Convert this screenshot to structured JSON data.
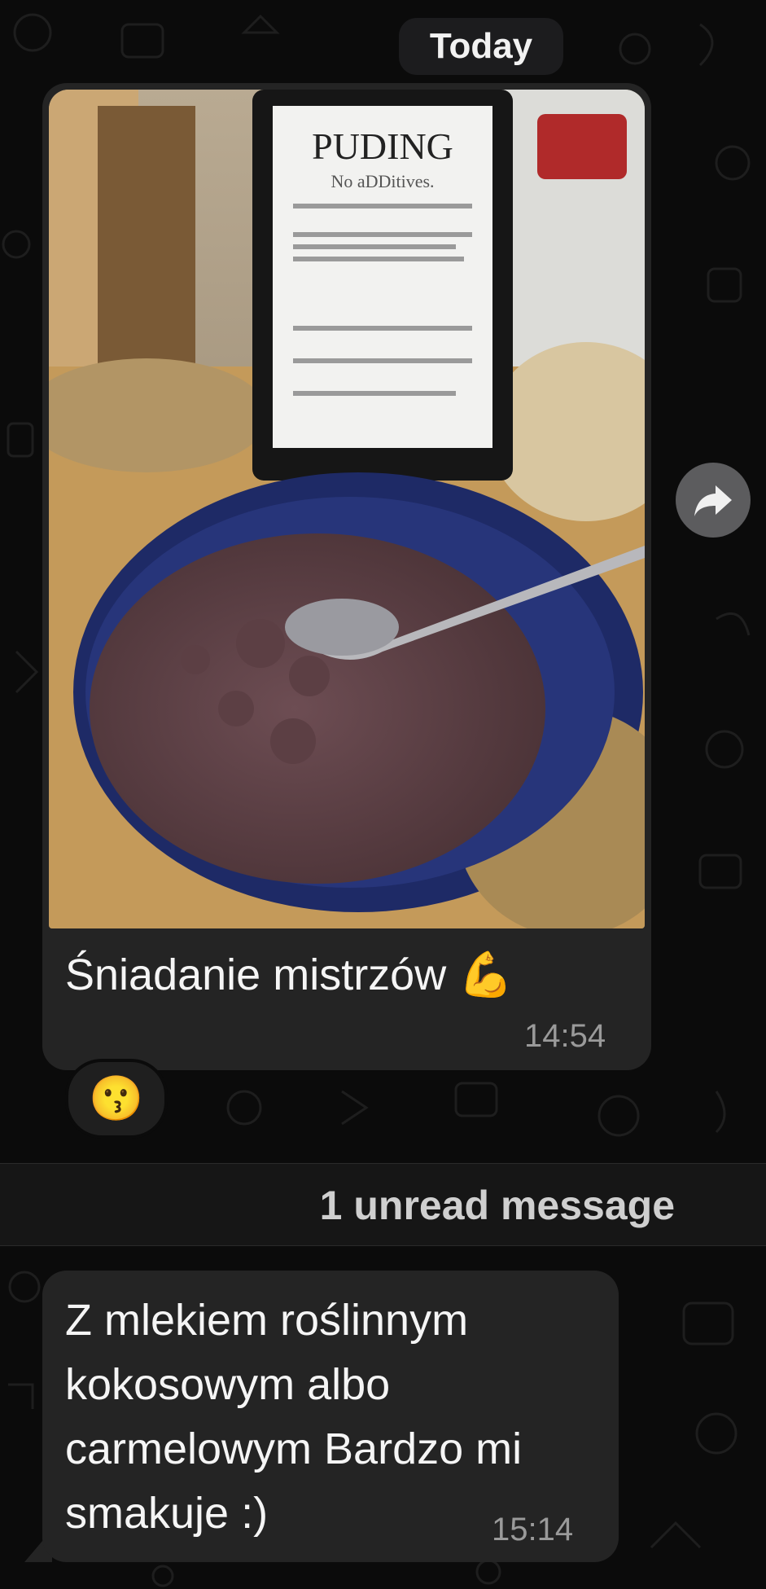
{
  "chat": {
    "date_label": "Today",
    "unread_label": "1 unread message",
    "colors": {
      "background": "#0b0b0b",
      "bubble": "#242424",
      "timestamp": "#9a9a9a"
    }
  },
  "messages": [
    {
      "type": "photo",
      "photo_label": "PUDING",
      "photo_sublabel": "No aDDitives.",
      "caption": "Śniadanie mistrzów 💪",
      "time": "14:54",
      "reaction": "😗",
      "forward_icon": "share-arrow-icon"
    },
    {
      "type": "text",
      "text_lines": [
        "Z mlekiem roślinnym",
        "kokosowym albo",
        "carmelowym Bardzo mi",
        "smakuje  :)"
      ],
      "time": "15:14"
    }
  ]
}
